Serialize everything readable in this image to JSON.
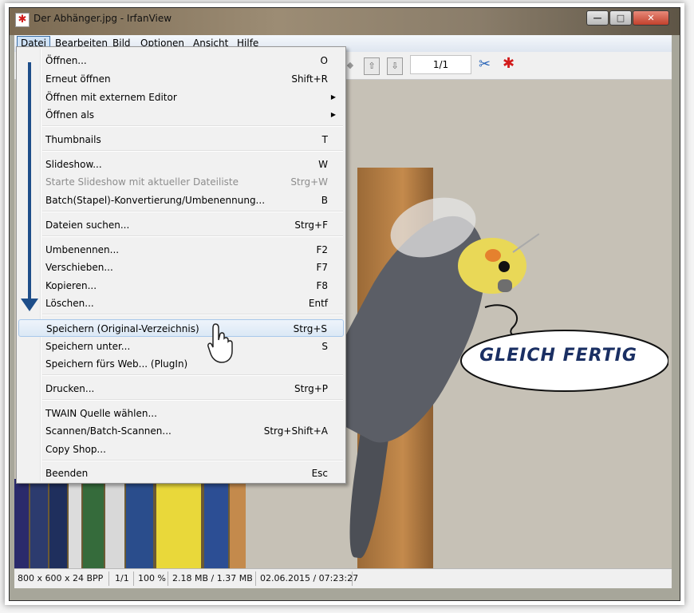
{
  "window": {
    "title": "Der Abhänger.jpg - IrfanView",
    "minimize_label": "—",
    "maximize_label": "□",
    "close_label": "✕",
    "app_icon": "irfanview-icon"
  },
  "menubar": [
    {
      "label": "Datei",
      "active": true
    },
    {
      "label": "Bearbeiten"
    },
    {
      "label": "Bild"
    },
    {
      "label": "Optionen"
    },
    {
      "label": "Ansicht"
    },
    {
      "label": "Hilfe"
    }
  ],
  "toolbar": {
    "page_counter": "1/1",
    "icons": [
      "next-icon",
      "prev-page-icon",
      "next-page-icon",
      "tools-icon",
      "bug-icon"
    ]
  },
  "dropdown": {
    "items": [
      {
        "label": "Öffnen...",
        "shortcut": "O"
      },
      {
        "label": "Erneut öffnen",
        "shortcut": "Shift+R"
      },
      {
        "label": "Öffnen mit externem Editor",
        "submenu": true
      },
      {
        "label": "Öffnen als",
        "submenu": true
      },
      {
        "label": "Thumbnails",
        "shortcut": "T"
      },
      {
        "label": "Slideshow...",
        "shortcut": "W"
      },
      {
        "label": "Starte Slideshow mit aktueller Dateiliste",
        "shortcut": "Strg+W",
        "disabled": true
      },
      {
        "label": "Batch(Stapel)-Konvertierung/Umbenennung...",
        "shortcut": "B"
      },
      {
        "label": "Dateien suchen...",
        "shortcut": "Strg+F"
      },
      {
        "label": "Umbenennen...",
        "shortcut": "F2"
      },
      {
        "label": "Verschieben...",
        "shortcut": "F7"
      },
      {
        "label": "Kopieren...",
        "shortcut": "F8"
      },
      {
        "label": "Löschen...",
        "shortcut": "Entf"
      },
      {
        "label": "Speichern (Original-Verzeichnis)",
        "shortcut": "Strg+S",
        "highlighted": true
      },
      {
        "label": "Speichern unter...",
        "shortcut": "S"
      },
      {
        "label": "Speichern fürs Web... (PlugIn)"
      },
      {
        "label": "Drucken...",
        "shortcut": "Strg+P"
      },
      {
        "label": "TWAIN Quelle wählen..."
      },
      {
        "label": "Scannen/Batch-Scannen...",
        "shortcut": "Strg+Shift+A"
      },
      {
        "label": "Copy Shop..."
      },
      {
        "label": "Beenden",
        "shortcut": "Esc"
      }
    ]
  },
  "image": {
    "speech_bubble_text": "GLEICH FERTIG"
  },
  "statusbar": {
    "dimensions": "800 x 600 x 24 BPP",
    "page": "1/1",
    "zoom": "100 %",
    "filesize": "2.18 MB / 1.37 MB",
    "datetime": "02.06.2015 / 07:23:27"
  },
  "colors": {
    "menu_highlight": "#cfe2f6",
    "arrow": "#1e4e8a",
    "bubble_text": "#1a2f63"
  }
}
